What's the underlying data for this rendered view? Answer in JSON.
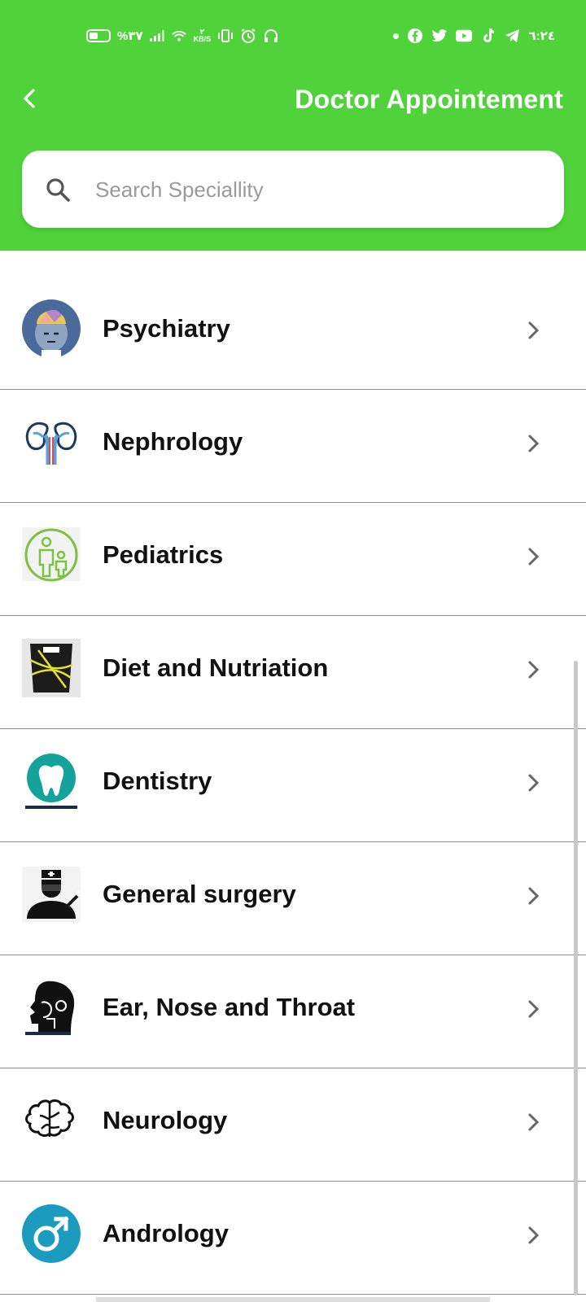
{
  "status_bar": {
    "battery_text": "%٣٧",
    "network_speed_top": "٢",
    "network_speed_unit": "KB/S",
    "time": "٦:٢٤"
  },
  "header": {
    "title": "Doctor Appointement",
    "background": "#50d33a"
  },
  "search": {
    "placeholder": "Search Speciallity"
  },
  "specialities": [
    {
      "label": "Psychiatry",
      "icon": "psychiatry-icon"
    },
    {
      "label": "Nephrology",
      "icon": "kidney-icon"
    },
    {
      "label": "Pediatrics",
      "icon": "parent-child-icon"
    },
    {
      "label": "Diet and Nutriation",
      "icon": "scale-tape-icon"
    },
    {
      "label": "Dentistry",
      "icon": "tooth-icon"
    },
    {
      "label": "General surgery",
      "icon": "surgeon-icon"
    },
    {
      "label": "Ear, Nose and Throat",
      "icon": "head-profile-icon"
    },
    {
      "label": "Neurology",
      "icon": "brain-icon"
    },
    {
      "label": "Andrology",
      "icon": "male-symbol-icon"
    }
  ]
}
